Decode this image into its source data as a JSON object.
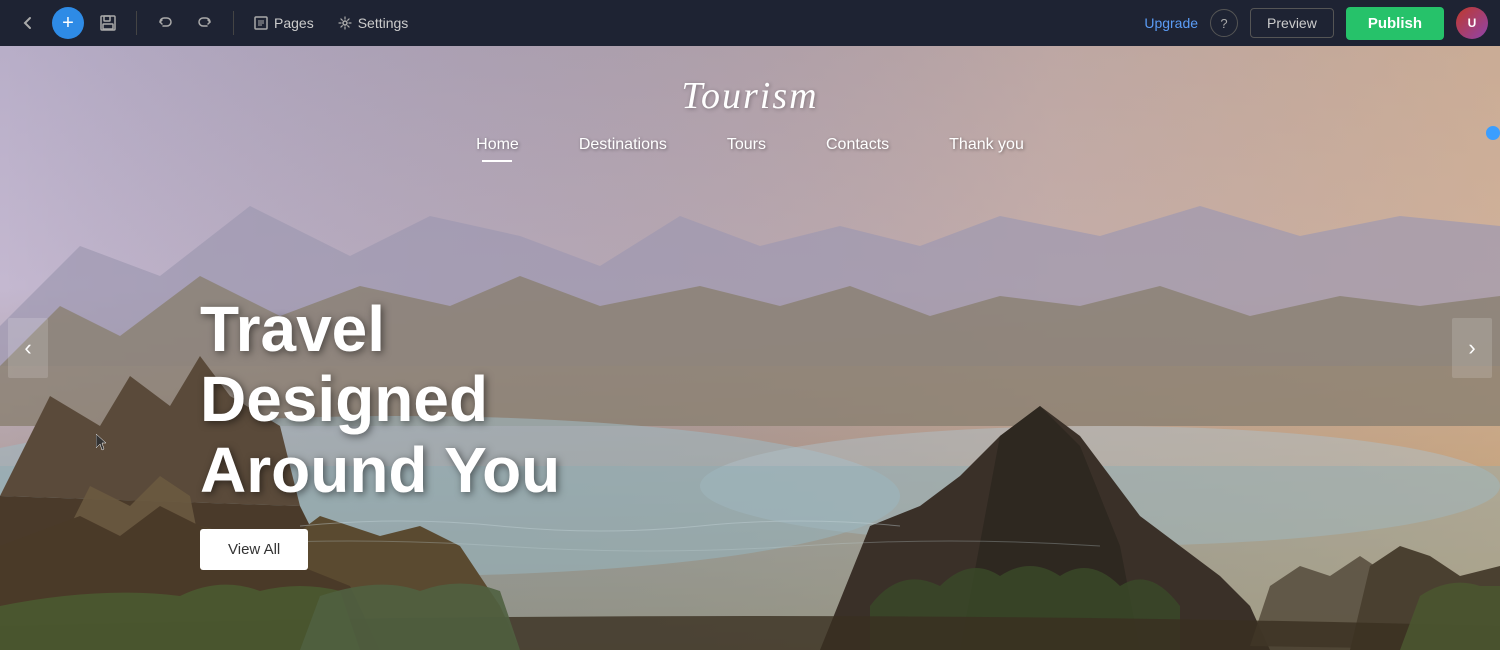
{
  "toolbar": {
    "back_label": "←",
    "add_label": "+",
    "save_label": "💾",
    "undo_label": "↩",
    "redo_label": "↪",
    "pages_label": "Pages",
    "settings_label": "Settings",
    "upgrade_label": "Upgrade",
    "help_label": "?",
    "preview_label": "Preview",
    "publish_label": "Publish",
    "avatar_initials": "U"
  },
  "site": {
    "title": "Tourism",
    "nav": {
      "items": [
        {
          "label": "Home",
          "active": true
        },
        {
          "label": "Destinations",
          "active": false
        },
        {
          "label": "Tours",
          "active": false
        },
        {
          "label": "Contacts",
          "active": false
        },
        {
          "label": "Thank you",
          "active": false
        }
      ]
    }
  },
  "hero": {
    "heading_line1": "Travel Designed",
    "heading_line2": "Around You",
    "cta_label": "View All"
  },
  "carousel": {
    "prev_label": "‹",
    "next_label": "›"
  }
}
